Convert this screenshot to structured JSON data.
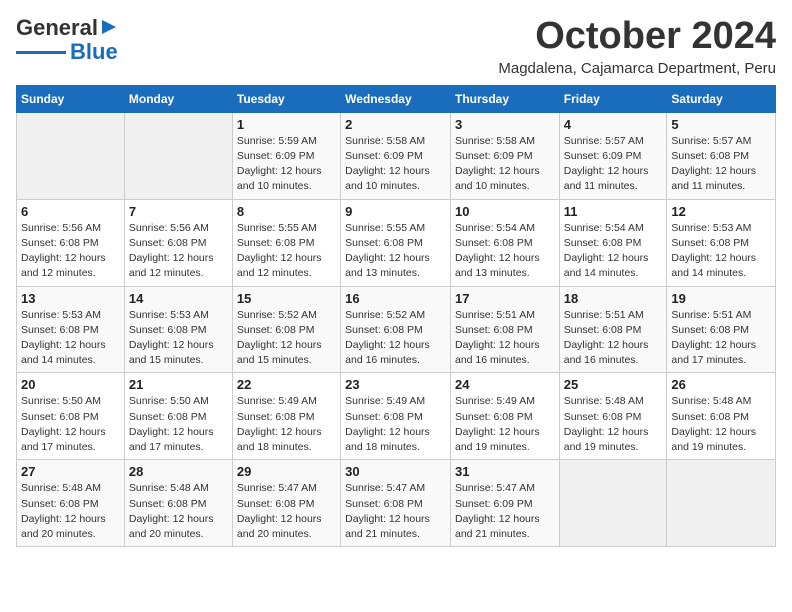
{
  "logo": {
    "line1": "General",
    "line2": "Blue",
    "tagline": ""
  },
  "title": "October 2024",
  "location": "Magdalena, Cajamarca Department, Peru",
  "days_header": [
    "Sunday",
    "Monday",
    "Tuesday",
    "Wednesday",
    "Thursday",
    "Friday",
    "Saturday"
  ],
  "weeks": [
    [
      {
        "num": "",
        "info": ""
      },
      {
        "num": "",
        "info": ""
      },
      {
        "num": "1",
        "info": "Sunrise: 5:59 AM\nSunset: 6:09 PM\nDaylight: 12 hours\nand 10 minutes."
      },
      {
        "num": "2",
        "info": "Sunrise: 5:58 AM\nSunset: 6:09 PM\nDaylight: 12 hours\nand 10 minutes."
      },
      {
        "num": "3",
        "info": "Sunrise: 5:58 AM\nSunset: 6:09 PM\nDaylight: 12 hours\nand 10 minutes."
      },
      {
        "num": "4",
        "info": "Sunrise: 5:57 AM\nSunset: 6:09 PM\nDaylight: 12 hours\nand 11 minutes."
      },
      {
        "num": "5",
        "info": "Sunrise: 5:57 AM\nSunset: 6:08 PM\nDaylight: 12 hours\nand 11 minutes."
      }
    ],
    [
      {
        "num": "6",
        "info": "Sunrise: 5:56 AM\nSunset: 6:08 PM\nDaylight: 12 hours\nand 12 minutes."
      },
      {
        "num": "7",
        "info": "Sunrise: 5:56 AM\nSunset: 6:08 PM\nDaylight: 12 hours\nand 12 minutes."
      },
      {
        "num": "8",
        "info": "Sunrise: 5:55 AM\nSunset: 6:08 PM\nDaylight: 12 hours\nand 12 minutes."
      },
      {
        "num": "9",
        "info": "Sunrise: 5:55 AM\nSunset: 6:08 PM\nDaylight: 12 hours\nand 13 minutes."
      },
      {
        "num": "10",
        "info": "Sunrise: 5:54 AM\nSunset: 6:08 PM\nDaylight: 12 hours\nand 13 minutes."
      },
      {
        "num": "11",
        "info": "Sunrise: 5:54 AM\nSunset: 6:08 PM\nDaylight: 12 hours\nand 14 minutes."
      },
      {
        "num": "12",
        "info": "Sunrise: 5:53 AM\nSunset: 6:08 PM\nDaylight: 12 hours\nand 14 minutes."
      }
    ],
    [
      {
        "num": "13",
        "info": "Sunrise: 5:53 AM\nSunset: 6:08 PM\nDaylight: 12 hours\nand 14 minutes."
      },
      {
        "num": "14",
        "info": "Sunrise: 5:53 AM\nSunset: 6:08 PM\nDaylight: 12 hours\nand 15 minutes."
      },
      {
        "num": "15",
        "info": "Sunrise: 5:52 AM\nSunset: 6:08 PM\nDaylight: 12 hours\nand 15 minutes."
      },
      {
        "num": "16",
        "info": "Sunrise: 5:52 AM\nSunset: 6:08 PM\nDaylight: 12 hours\nand 16 minutes."
      },
      {
        "num": "17",
        "info": "Sunrise: 5:51 AM\nSunset: 6:08 PM\nDaylight: 12 hours\nand 16 minutes."
      },
      {
        "num": "18",
        "info": "Sunrise: 5:51 AM\nSunset: 6:08 PM\nDaylight: 12 hours\nand 16 minutes."
      },
      {
        "num": "19",
        "info": "Sunrise: 5:51 AM\nSunset: 6:08 PM\nDaylight: 12 hours\nand 17 minutes."
      }
    ],
    [
      {
        "num": "20",
        "info": "Sunrise: 5:50 AM\nSunset: 6:08 PM\nDaylight: 12 hours\nand 17 minutes."
      },
      {
        "num": "21",
        "info": "Sunrise: 5:50 AM\nSunset: 6:08 PM\nDaylight: 12 hours\nand 17 minutes."
      },
      {
        "num": "22",
        "info": "Sunrise: 5:49 AM\nSunset: 6:08 PM\nDaylight: 12 hours\nand 18 minutes."
      },
      {
        "num": "23",
        "info": "Sunrise: 5:49 AM\nSunset: 6:08 PM\nDaylight: 12 hours\nand 18 minutes."
      },
      {
        "num": "24",
        "info": "Sunrise: 5:49 AM\nSunset: 6:08 PM\nDaylight: 12 hours\nand 19 minutes."
      },
      {
        "num": "25",
        "info": "Sunrise: 5:48 AM\nSunset: 6:08 PM\nDaylight: 12 hours\nand 19 minutes."
      },
      {
        "num": "26",
        "info": "Sunrise: 5:48 AM\nSunset: 6:08 PM\nDaylight: 12 hours\nand 19 minutes."
      }
    ],
    [
      {
        "num": "27",
        "info": "Sunrise: 5:48 AM\nSunset: 6:08 PM\nDaylight: 12 hours\nand 20 minutes."
      },
      {
        "num": "28",
        "info": "Sunrise: 5:48 AM\nSunset: 6:08 PM\nDaylight: 12 hours\nand 20 minutes."
      },
      {
        "num": "29",
        "info": "Sunrise: 5:47 AM\nSunset: 6:08 PM\nDaylight: 12 hours\nand 20 minutes."
      },
      {
        "num": "30",
        "info": "Sunrise: 5:47 AM\nSunset: 6:08 PM\nDaylight: 12 hours\nand 21 minutes."
      },
      {
        "num": "31",
        "info": "Sunrise: 5:47 AM\nSunset: 6:09 PM\nDaylight: 12 hours\nand 21 minutes."
      },
      {
        "num": "",
        "info": ""
      },
      {
        "num": "",
        "info": ""
      }
    ]
  ]
}
